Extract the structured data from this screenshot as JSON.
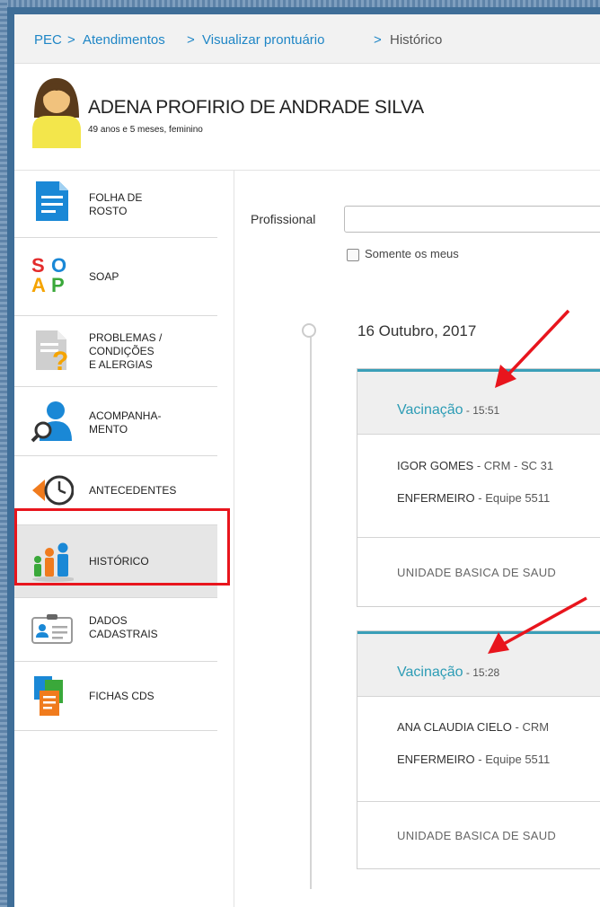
{
  "breadcrumb": {
    "items": [
      "PEC",
      "Atendimentos",
      "Visualizar prontuário"
    ],
    "separator": ">",
    "current": "Histórico"
  },
  "patient": {
    "name": "ADENA PROFIRIO DE ANDRADE SILVA",
    "subtitle": "49 anos e 5 meses, feminino"
  },
  "sidebar": {
    "items": [
      {
        "label": "FOLHA DE\nROSTO",
        "icon": "document-icon"
      },
      {
        "label": "SOAP",
        "icon": "soap-icon"
      },
      {
        "label": "PROBLEMAS /\nCONDIÇÕES\nE ALERGIAS",
        "icon": "problems-icon"
      },
      {
        "label": "ACOMPANHA-\nMENTO",
        "icon": "person-search-icon"
      },
      {
        "label": "ANTECEDENTES",
        "icon": "clock-back-icon"
      },
      {
        "label": "HISTÓRICO",
        "icon": "family-icon"
      },
      {
        "label": "DADOS\nCADASTRAIS",
        "icon": "id-card-icon"
      },
      {
        "label": "FICHAS CDS",
        "icon": "forms-icon"
      }
    ],
    "active": "HISTÓRICO"
  },
  "filter": {
    "label": "Profissional",
    "value": "",
    "only_mine_label": "Somente os meus",
    "only_mine_checked": false
  },
  "timeline": {
    "date_day": "16 Outubro",
    "date_year": ", 2017",
    "entries": [
      {
        "title": "Vacinação",
        "time": " - 15:51",
        "professional_name": "IGOR GOMES",
        "professional_detail": " - CRM - SC 31",
        "role": "ENFERMEIRO",
        "team": " - Equipe 5511",
        "unit": "UNIDADE BASICA DE SAUD"
      },
      {
        "title": "Vacinação",
        "time": " - 15:28",
        "professional_name": "ANA CLAUDIA CIELO",
        "professional_detail": " - CRM",
        "role": "ENFERMEIRO",
        "team": " - Equipe 5511",
        "unit": "UNIDADE BASICA DE SAUD"
      }
    ]
  },
  "colors": {
    "link": "#1f86c6",
    "accent": "#2c9cb5",
    "highlight": "#e8151d",
    "frame": "#3f6e98"
  }
}
